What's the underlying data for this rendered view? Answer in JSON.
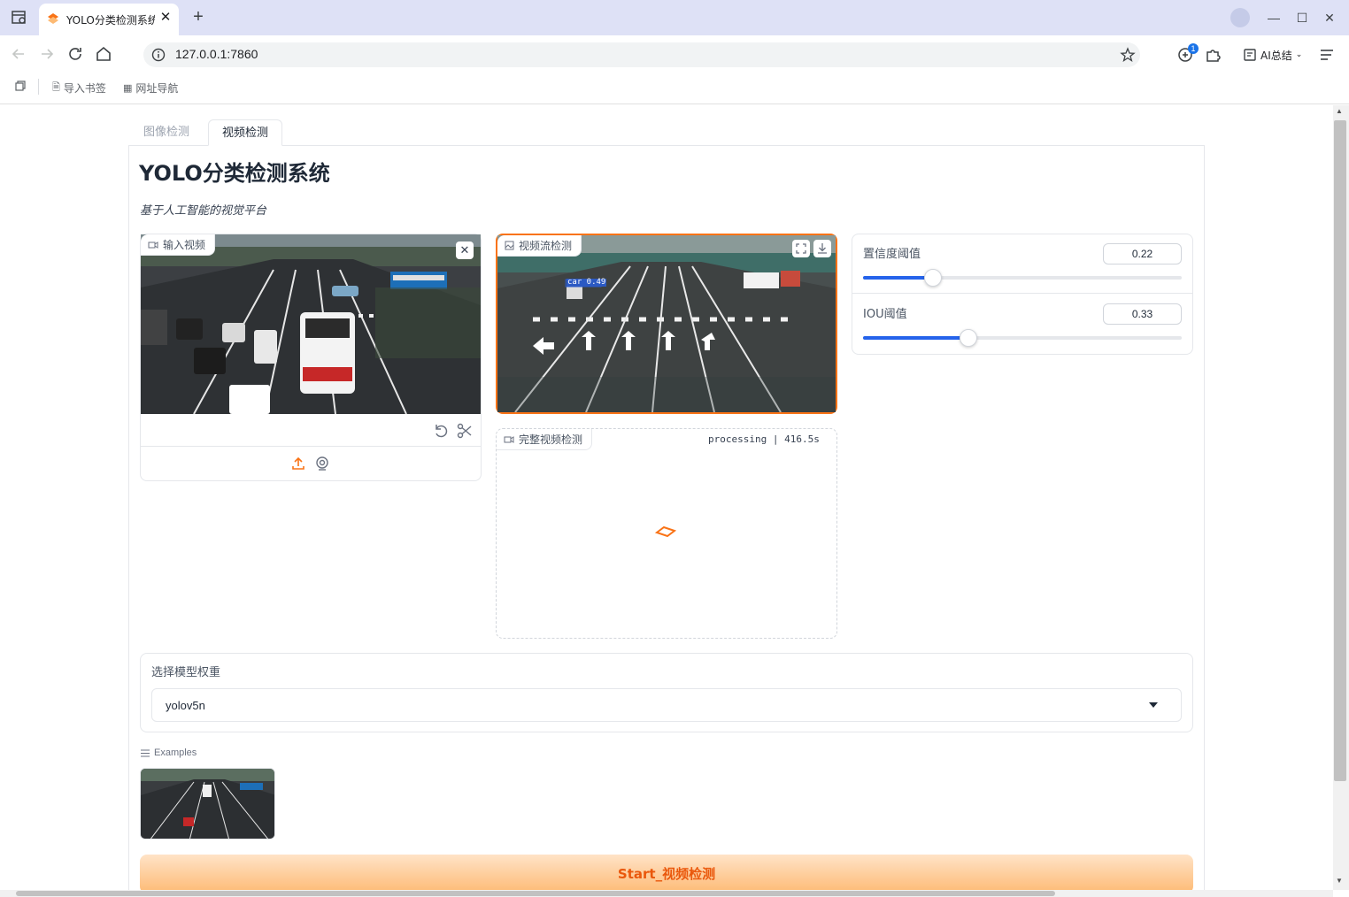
{
  "browser": {
    "tab_title": "YOLO分类检测系统",
    "url": "127.0.0.1:7860",
    "extension_badge": "1",
    "ai_summary_label": "AI总结",
    "bookmarks": [
      "导入书签",
      "网址导航"
    ]
  },
  "page": {
    "tabs": [
      "图像检测",
      "视频检测"
    ],
    "active_tab": "视频检测",
    "title": "YOLO分类检测系统",
    "subtitle": "基于人工智能的视觉平台"
  },
  "input_video": {
    "label": "输入视频"
  },
  "stream_output": {
    "label": "视频流检测",
    "detection_tag": "car 0.49"
  },
  "full_output": {
    "label": "完整视频检测",
    "status": "processing | 416.5s"
  },
  "sliders": {
    "confidence": {
      "label": "置信度阈值",
      "value": "0.22",
      "fraction": 0.22
    },
    "iou": {
      "label": "IOU阈值",
      "value": "0.33",
      "fraction": 0.33
    }
  },
  "model": {
    "label": "选择模型权重",
    "selected": "yolov5n"
  },
  "examples": {
    "label": "Examples"
  },
  "start_button": {
    "label": "Start_视频检测"
  },
  "colors": {
    "accent": "#f97316",
    "slider": "#2563eb",
    "button_bg": "#fdba74"
  }
}
